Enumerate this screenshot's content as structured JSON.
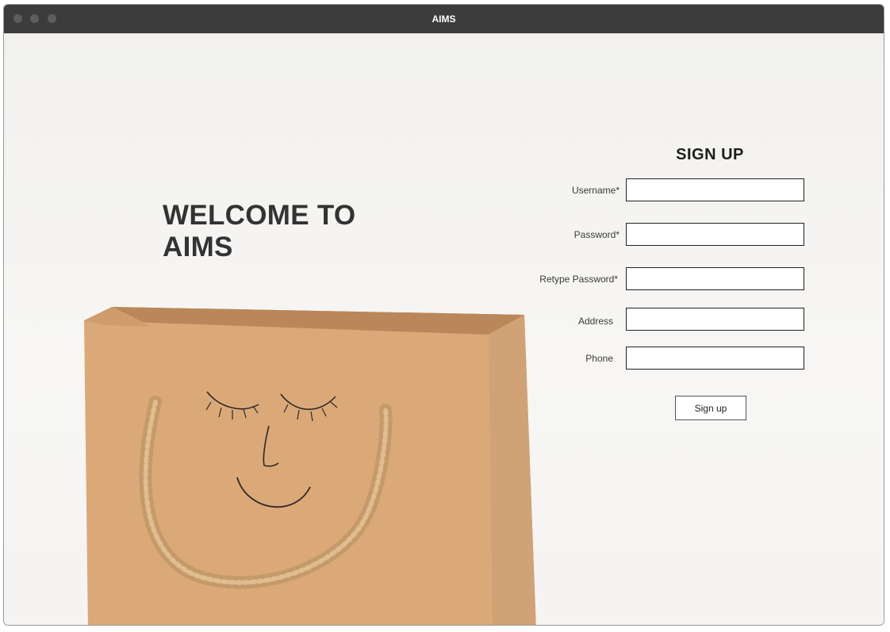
{
  "window": {
    "title": "AIMS"
  },
  "hero": {
    "welcome_text": "WELCOME TO AIMS"
  },
  "signup": {
    "title": "SIGN UP",
    "fields": [
      {
        "label": "Username*",
        "value": "",
        "placeholder": ""
      },
      {
        "label": "Password*",
        "value": "",
        "placeholder": ""
      },
      {
        "label": "Retype Password*",
        "value": "",
        "placeholder": ""
      },
      {
        "label": "Address",
        "value": "",
        "placeholder": ""
      },
      {
        "label": "Phone",
        "value": "",
        "placeholder": ""
      }
    ],
    "button_label": "Sign up"
  }
}
